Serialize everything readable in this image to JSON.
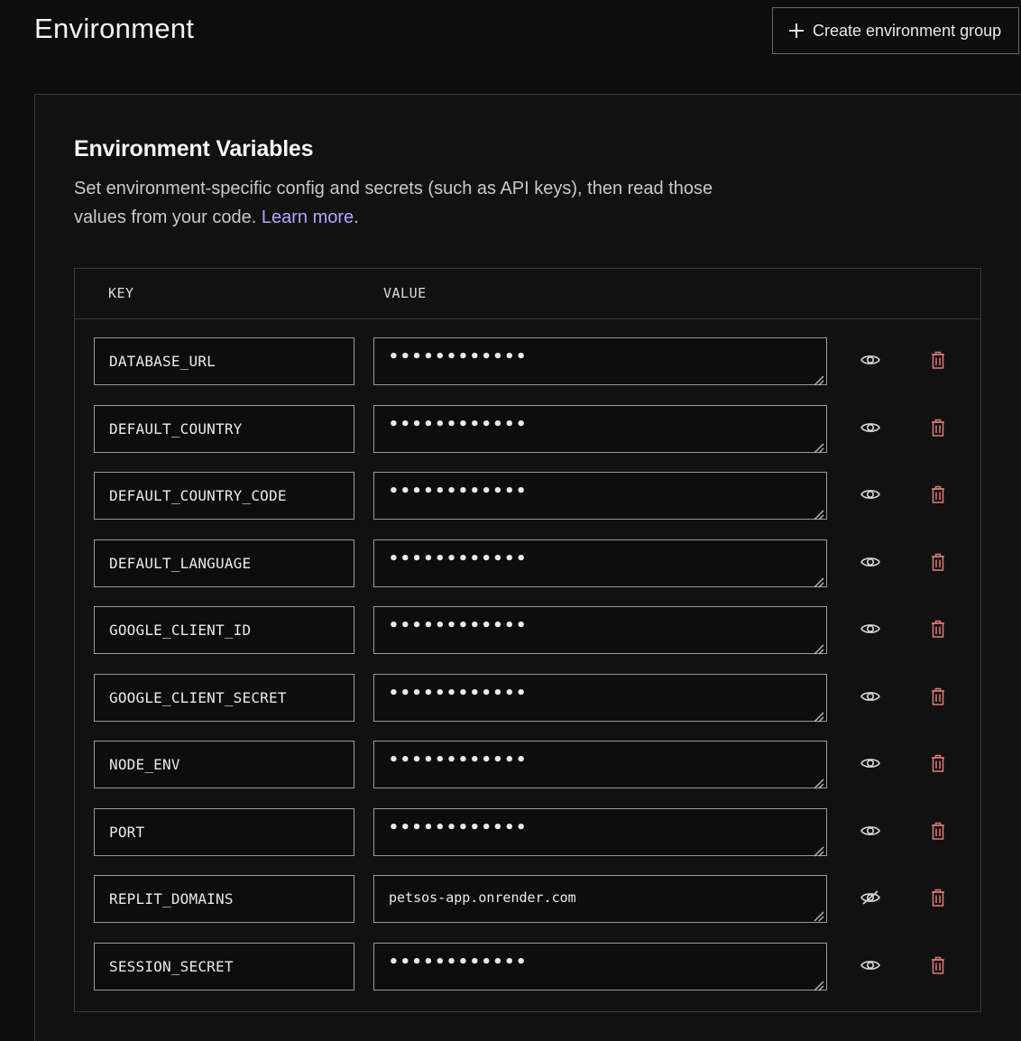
{
  "header": {
    "title": "Environment",
    "create_button_label": "Create environment group"
  },
  "section": {
    "title": "Environment Variables",
    "description": "Set environment-specific config and secrets (such as API keys), then read those values from your code.",
    "learn_more": "Learn more",
    "period": "."
  },
  "table": {
    "col_key": "KEY",
    "col_value": "VALUE",
    "rows": [
      {
        "key": "DATABASE_URL",
        "value": "••••••••••••",
        "revealed": false
      },
      {
        "key": "DEFAULT_COUNTRY",
        "value": "••••••••••••",
        "revealed": false
      },
      {
        "key": "DEFAULT_COUNTRY_CODE",
        "value": "••••••••••••",
        "revealed": false
      },
      {
        "key": "DEFAULT_LANGUAGE",
        "value": "••••••••••••",
        "revealed": false
      },
      {
        "key": "GOOGLE_CLIENT_ID",
        "value": "••••••••••••",
        "revealed": false
      },
      {
        "key": "GOOGLE_CLIENT_SECRET",
        "value": "••••••••••••",
        "revealed": false
      },
      {
        "key": "NODE_ENV",
        "value": "••••••••••••",
        "revealed": false
      },
      {
        "key": "PORT",
        "value": "••••••••••••",
        "revealed": false
      },
      {
        "key": "REPLIT_DOMAINS",
        "value": "petsos-app.onrender.com",
        "revealed": true
      },
      {
        "key": "SESSION_SECRET",
        "value": "••••••••••••",
        "revealed": false
      }
    ]
  },
  "icons": {
    "show": "eye-icon",
    "hide": "eye-off-icon",
    "delete": "trash-icon",
    "add": "plus-icon",
    "resize": "resize-handle-icon"
  },
  "colors": {
    "background": "#0d0d0d",
    "link": "#b8a4ff",
    "trash": "#e07a7a"
  }
}
